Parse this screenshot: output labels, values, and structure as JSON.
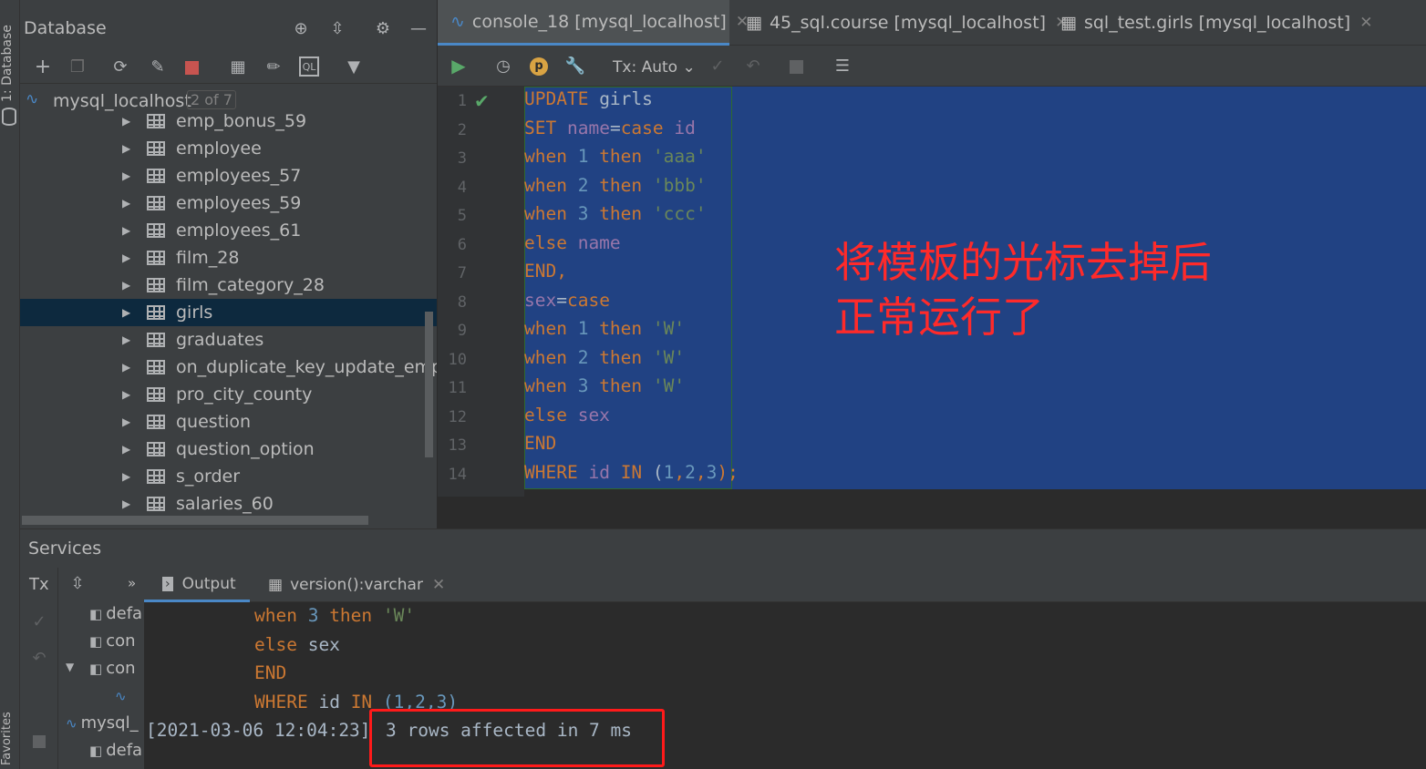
{
  "left_strip": {
    "database_label": "1: Database",
    "favorites_label": "Favorites"
  },
  "database_panel": {
    "title": "Database",
    "connection": {
      "name": "mysql_localhost",
      "badge": "2 of 7"
    },
    "items": [
      {
        "label": "emp_bonus_59"
      },
      {
        "label": "employee"
      },
      {
        "label": "employees_57"
      },
      {
        "label": "employees_59"
      },
      {
        "label": "employees_61"
      },
      {
        "label": "film_28"
      },
      {
        "label": "film_category_28"
      },
      {
        "label": "girls",
        "selected": true
      },
      {
        "label": "graduates"
      },
      {
        "label": "on_duplicate_key_update_employ"
      },
      {
        "label": "pro_city_county"
      },
      {
        "label": "question"
      },
      {
        "label": "question_option"
      },
      {
        "label": "s_order"
      },
      {
        "label": "salaries_60"
      }
    ]
  },
  "editor": {
    "tabs": [
      {
        "label": "console_18 [mysql_localhost]",
        "active": true
      },
      {
        "label": "45_sql.course [mysql_localhost]"
      },
      {
        "label": "sql_test.girls [mysql_localhost]"
      }
    ],
    "tx_mode": "Tx: Auto",
    "line_numbers": [
      "1",
      "2",
      "3",
      "4",
      "5",
      "6",
      "7",
      "8",
      "9",
      "10",
      "11",
      "12",
      "13",
      "14"
    ],
    "code_lines": [
      [
        {
          "t": "UPDATE",
          "c": "kw"
        },
        {
          "t": " girls",
          "c": ""
        }
      ],
      [
        {
          "t": "SET ",
          "c": "kw"
        },
        {
          "t": "name",
          "c": "fld"
        },
        {
          "t": "=",
          "c": ""
        },
        {
          "t": "case ",
          "c": "kw"
        },
        {
          "t": "id",
          "c": "fld"
        }
      ],
      [
        {
          "t": "when ",
          "c": "kw"
        },
        {
          "t": "1 ",
          "c": "num"
        },
        {
          "t": "then ",
          "c": "kw"
        },
        {
          "t": "'aaa'",
          "c": "str"
        }
      ],
      [
        {
          "t": "when ",
          "c": "kw"
        },
        {
          "t": "2 ",
          "c": "num"
        },
        {
          "t": "then ",
          "c": "kw"
        },
        {
          "t": "'bbb'",
          "c": "str"
        }
      ],
      [
        {
          "t": "when ",
          "c": "kw"
        },
        {
          "t": "3 ",
          "c": "num"
        },
        {
          "t": "then ",
          "c": "kw"
        },
        {
          "t": "'ccc'",
          "c": "str"
        }
      ],
      [
        {
          "t": "else ",
          "c": "kw"
        },
        {
          "t": "name",
          "c": "fld"
        }
      ],
      [
        {
          "t": "END,",
          "c": "kw"
        }
      ],
      [
        {
          "t": "sex",
          "c": "fld"
        },
        {
          "t": "=",
          "c": ""
        },
        {
          "t": "case",
          "c": "kw"
        }
      ],
      [
        {
          "t": "when ",
          "c": "kw"
        },
        {
          "t": "1 ",
          "c": "num"
        },
        {
          "t": "then ",
          "c": "kw"
        },
        {
          "t": "'W'",
          "c": "str"
        }
      ],
      [
        {
          "t": "when ",
          "c": "kw"
        },
        {
          "t": "2 ",
          "c": "num"
        },
        {
          "t": "then ",
          "c": "kw"
        },
        {
          "t": "'W'",
          "c": "str"
        }
      ],
      [
        {
          "t": "when ",
          "c": "kw"
        },
        {
          "t": "3 ",
          "c": "num"
        },
        {
          "t": "then ",
          "c": "kw"
        },
        {
          "t": "'W'",
          "c": "str"
        }
      ],
      [
        {
          "t": "else ",
          "c": "kw"
        },
        {
          "t": "sex",
          "c": "fld"
        }
      ],
      [
        {
          "t": "END",
          "c": "kw"
        }
      ],
      [
        {
          "t": "WHERE ",
          "c": "kw"
        },
        {
          "t": "id ",
          "c": "fld"
        },
        {
          "t": "IN ",
          "c": "kw"
        },
        {
          "t": "(",
          "c": ""
        },
        {
          "t": "1",
          "c": "num"
        },
        {
          "t": ",",
          "c": "kw"
        },
        {
          "t": "2",
          "c": "num"
        },
        {
          "t": ",",
          "c": "kw"
        },
        {
          "t": "3",
          "c": "num"
        },
        {
          "t": ");",
          "c": "kw"
        }
      ]
    ],
    "annotation_line1": "将模板的光标去掉后",
    "annotation_line2": "正常运行了"
  },
  "services": {
    "title": "Services",
    "tx_label": "Tx",
    "tree_items": [
      "defa",
      "con",
      "con",
      "",
      "mysql_",
      "defa"
    ],
    "tabs": [
      {
        "label": "Output",
        "active": true
      },
      {
        "label": "version():varchar"
      }
    ],
    "output_lines": [
      [
        {
          "t": "when ",
          "c": "kw"
        },
        {
          "t": "3 ",
          "c": "num"
        },
        {
          "t": "then ",
          "c": "kw"
        },
        {
          "t": "'W'",
          "c": "str"
        }
      ],
      [
        {
          "t": "else ",
          "c": "kw"
        },
        {
          "t": "sex",
          "c": ""
        }
      ],
      [
        {
          "t": "END",
          "c": "kw"
        }
      ],
      [
        {
          "t": "WHERE ",
          "c": "kw"
        },
        {
          "t": "id ",
          "c": ""
        },
        {
          "t": "IN ",
          "c": "kw"
        },
        {
          "t": "(1,2,3)",
          "c": "num"
        }
      ]
    ],
    "log_timestamp": "[2021-03-06 12:04:23]",
    "log_message": "3 rows affected in 7 ms"
  }
}
